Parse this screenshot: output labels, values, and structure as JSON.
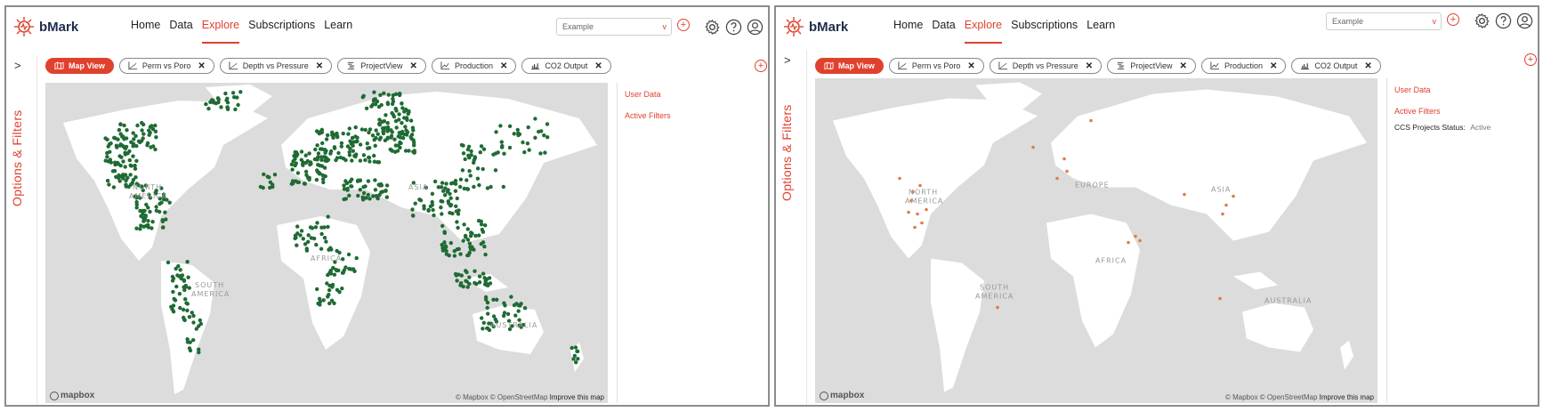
{
  "brand": {
    "name": "bMark",
    "accent": "#e0412e",
    "dot_color_left": "#1f6b34",
    "dot_color_right": "#e07a4a"
  },
  "nav": [
    "Home",
    "Data",
    "Explore",
    "Subscriptions",
    "Learn"
  ],
  "nav_active": "Explore",
  "search": {
    "value": "Example",
    "chevron": "v"
  },
  "sidebar": {
    "expand_glyph": ">",
    "label": "Options & Filters"
  },
  "tabs": [
    {
      "label": "Map View",
      "icon": "map-icon",
      "active": true
    },
    {
      "label": "Perm vs Poro",
      "icon": "scatter-chart-icon",
      "close": "✕"
    },
    {
      "label": "Depth vs Pressure",
      "icon": "scatter-chart-icon",
      "close": "✕"
    },
    {
      "label": "ProjectView",
      "icon": "project-view-icon",
      "close": "✕"
    },
    {
      "label": "Production",
      "icon": "line-chart-icon",
      "close": "✕"
    },
    {
      "label": "CO2 Output",
      "icon": "bar-chart-icon",
      "close": "✕"
    }
  ],
  "map": {
    "attribution": "© Mapbox © OpenStreetMap",
    "improve": "Improve this map",
    "provider_logo": "mapbox",
    "labels_left": [
      "ASIA",
      "AFRICA",
      "SOUTH",
      "AMERICA",
      "AUSTRALIA",
      "NORTH",
      "AMERICA"
    ],
    "labels_right": [
      "NORTH",
      "AMERICA",
      "EUROPE",
      "ASIA",
      "AFRICA",
      "SOUTH",
      "AMERICA",
      "AUSTRALIA"
    ]
  },
  "side_panel": {
    "user_data": "User Data",
    "active_filters": "Active Filters",
    "filter_key": "CCS Projects Status:",
    "filter_value": "Active"
  }
}
